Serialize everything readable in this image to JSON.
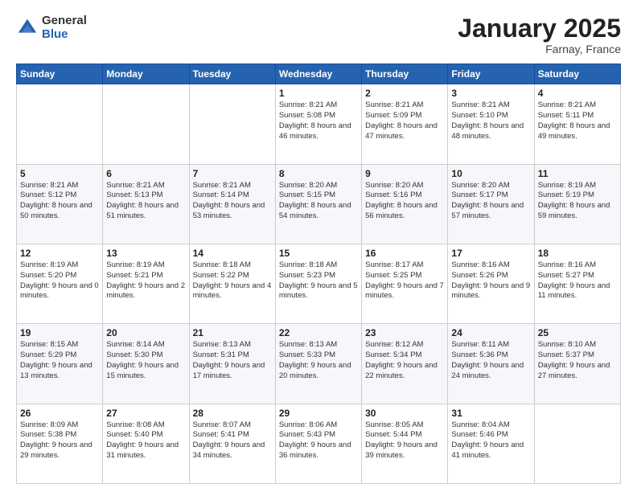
{
  "logo": {
    "general": "General",
    "blue": "Blue"
  },
  "title": "January 2025",
  "location": "Farnay, France",
  "days_of_week": [
    "Sunday",
    "Monday",
    "Tuesday",
    "Wednesday",
    "Thursday",
    "Friday",
    "Saturday"
  ],
  "weeks": [
    [
      {
        "day": "",
        "info": ""
      },
      {
        "day": "",
        "info": ""
      },
      {
        "day": "",
        "info": ""
      },
      {
        "day": "1",
        "info": "Sunrise: 8:21 AM\nSunset: 5:08 PM\nDaylight: 8 hours and 46 minutes."
      },
      {
        "day": "2",
        "info": "Sunrise: 8:21 AM\nSunset: 5:09 PM\nDaylight: 8 hours and 47 minutes."
      },
      {
        "day": "3",
        "info": "Sunrise: 8:21 AM\nSunset: 5:10 PM\nDaylight: 8 hours and 48 minutes."
      },
      {
        "day": "4",
        "info": "Sunrise: 8:21 AM\nSunset: 5:11 PM\nDaylight: 8 hours and 49 minutes."
      }
    ],
    [
      {
        "day": "5",
        "info": "Sunrise: 8:21 AM\nSunset: 5:12 PM\nDaylight: 8 hours and 50 minutes."
      },
      {
        "day": "6",
        "info": "Sunrise: 8:21 AM\nSunset: 5:13 PM\nDaylight: 8 hours and 51 minutes."
      },
      {
        "day": "7",
        "info": "Sunrise: 8:21 AM\nSunset: 5:14 PM\nDaylight: 8 hours and 53 minutes."
      },
      {
        "day": "8",
        "info": "Sunrise: 8:20 AM\nSunset: 5:15 PM\nDaylight: 8 hours and 54 minutes."
      },
      {
        "day": "9",
        "info": "Sunrise: 8:20 AM\nSunset: 5:16 PM\nDaylight: 8 hours and 56 minutes."
      },
      {
        "day": "10",
        "info": "Sunrise: 8:20 AM\nSunset: 5:17 PM\nDaylight: 8 hours and 57 minutes."
      },
      {
        "day": "11",
        "info": "Sunrise: 8:19 AM\nSunset: 5:19 PM\nDaylight: 8 hours and 59 minutes."
      }
    ],
    [
      {
        "day": "12",
        "info": "Sunrise: 8:19 AM\nSunset: 5:20 PM\nDaylight: 9 hours and 0 minutes."
      },
      {
        "day": "13",
        "info": "Sunrise: 8:19 AM\nSunset: 5:21 PM\nDaylight: 9 hours and 2 minutes."
      },
      {
        "day": "14",
        "info": "Sunrise: 8:18 AM\nSunset: 5:22 PM\nDaylight: 9 hours and 4 minutes."
      },
      {
        "day": "15",
        "info": "Sunrise: 8:18 AM\nSunset: 5:23 PM\nDaylight: 9 hours and 5 minutes."
      },
      {
        "day": "16",
        "info": "Sunrise: 8:17 AM\nSunset: 5:25 PM\nDaylight: 9 hours and 7 minutes."
      },
      {
        "day": "17",
        "info": "Sunrise: 8:16 AM\nSunset: 5:26 PM\nDaylight: 9 hours and 9 minutes."
      },
      {
        "day": "18",
        "info": "Sunrise: 8:16 AM\nSunset: 5:27 PM\nDaylight: 9 hours and 11 minutes."
      }
    ],
    [
      {
        "day": "19",
        "info": "Sunrise: 8:15 AM\nSunset: 5:29 PM\nDaylight: 9 hours and 13 minutes."
      },
      {
        "day": "20",
        "info": "Sunrise: 8:14 AM\nSunset: 5:30 PM\nDaylight: 9 hours and 15 minutes."
      },
      {
        "day": "21",
        "info": "Sunrise: 8:13 AM\nSunset: 5:31 PM\nDaylight: 9 hours and 17 minutes."
      },
      {
        "day": "22",
        "info": "Sunrise: 8:13 AM\nSunset: 5:33 PM\nDaylight: 9 hours and 20 minutes."
      },
      {
        "day": "23",
        "info": "Sunrise: 8:12 AM\nSunset: 5:34 PM\nDaylight: 9 hours and 22 minutes."
      },
      {
        "day": "24",
        "info": "Sunrise: 8:11 AM\nSunset: 5:36 PM\nDaylight: 9 hours and 24 minutes."
      },
      {
        "day": "25",
        "info": "Sunrise: 8:10 AM\nSunset: 5:37 PM\nDaylight: 9 hours and 27 minutes."
      }
    ],
    [
      {
        "day": "26",
        "info": "Sunrise: 8:09 AM\nSunset: 5:38 PM\nDaylight: 9 hours and 29 minutes."
      },
      {
        "day": "27",
        "info": "Sunrise: 8:08 AM\nSunset: 5:40 PM\nDaylight: 9 hours and 31 minutes."
      },
      {
        "day": "28",
        "info": "Sunrise: 8:07 AM\nSunset: 5:41 PM\nDaylight: 9 hours and 34 minutes."
      },
      {
        "day": "29",
        "info": "Sunrise: 8:06 AM\nSunset: 5:43 PM\nDaylight: 9 hours and 36 minutes."
      },
      {
        "day": "30",
        "info": "Sunrise: 8:05 AM\nSunset: 5:44 PM\nDaylight: 9 hours and 39 minutes."
      },
      {
        "day": "31",
        "info": "Sunrise: 8:04 AM\nSunset: 5:46 PM\nDaylight: 9 hours and 41 minutes."
      },
      {
        "day": "",
        "info": ""
      }
    ]
  ]
}
